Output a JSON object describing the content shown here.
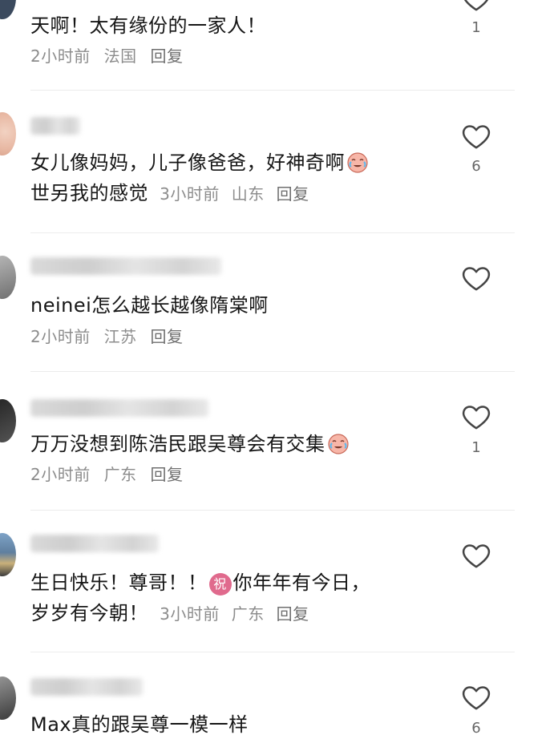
{
  "comments": [
    {
      "text": "天啊！太有缘份的一家人！",
      "time": "2小时前",
      "location": "法国",
      "reply": "回复",
      "likes": "1"
    },
    {
      "text_line1": "女儿像妈妈，儿子像爸爸，好神奇啊",
      "text_line2": "世另我的感觉",
      "time": "3小时前",
      "location": "山东",
      "reply": "回复",
      "likes": "6",
      "emoji": "crying-laughing-emoji"
    },
    {
      "text": "neinei怎么越长越像隋棠啊",
      "time": "2小时前",
      "location": "江苏",
      "reply": "回复",
      "likes": ""
    },
    {
      "text": "万万没想到陈浩民跟吴尊会有交集",
      "time": "2小时前",
      "location": "广东",
      "reply": "回复",
      "likes": "1",
      "emoji": "crying-laughing-emoji"
    },
    {
      "text_line1a": "生日快乐！尊哥！！",
      "badge": "祝",
      "text_line1b": "你年年有今日，",
      "text_line2": "岁岁有今朝！",
      "time": "3小时前",
      "location": "广东",
      "reply": "回复",
      "likes": ""
    },
    {
      "text": "Max真的跟吴尊一模一样",
      "likes": "6"
    }
  ],
  "icons": {
    "like": "heart-outline-icon"
  },
  "colors": {
    "text": "#161616",
    "meta": "#8c8c8c",
    "heart": "#444444",
    "divider": "#ececec",
    "badge": "#e06a8d"
  }
}
